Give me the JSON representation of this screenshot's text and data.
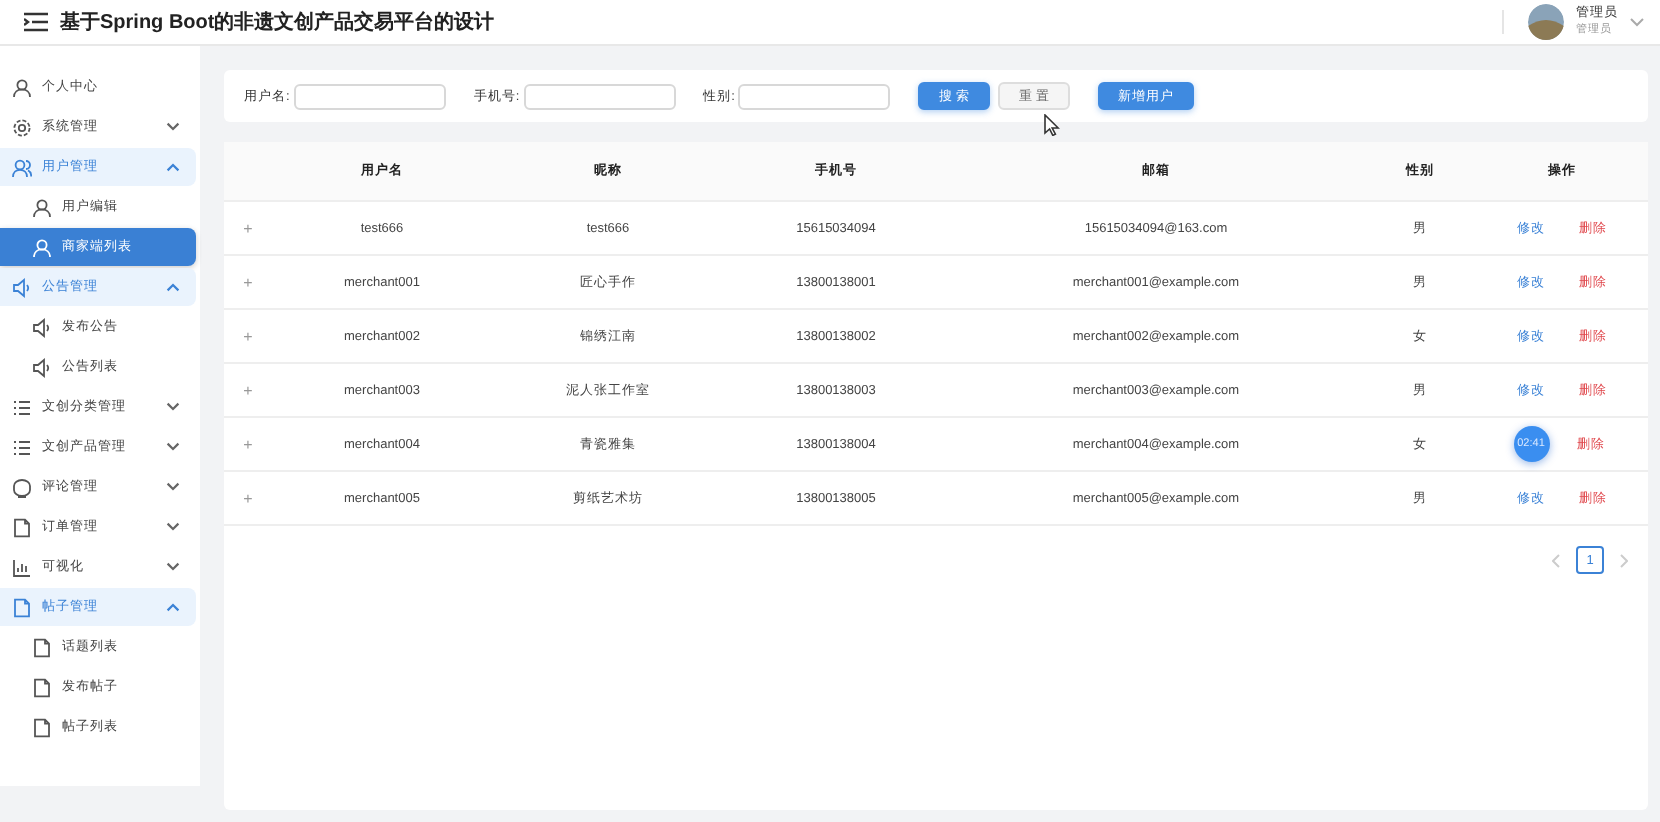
{
  "header": {
    "title": "基于Spring Boot的非遗文创产品交易平台的设计",
    "user_name": "管理员",
    "user_role": "管理员"
  },
  "sidebar": {
    "items": [
      {
        "label": "个人中心",
        "kind": "user",
        "selected": false
      },
      {
        "label": "系统管理",
        "kind": "gear",
        "expanded": false,
        "selected": false
      },
      {
        "label": "用户管理",
        "kind": "users",
        "expanded": true,
        "selected": false,
        "children": [
          {
            "label": "用户编辑",
            "kind": "user",
            "selected": false
          },
          {
            "label": "商家端列表",
            "kind": "user",
            "selected": true
          }
        ]
      },
      {
        "label": "公告管理",
        "kind": "speaker",
        "expanded": true,
        "selected": false,
        "children": [
          {
            "label": "发布公告",
            "kind": "speaker",
            "selected": false
          },
          {
            "label": "公告列表",
            "kind": "speaker",
            "selected": false
          }
        ]
      },
      {
        "label": "文创分类管理",
        "kind": "list",
        "expanded": false,
        "selected": false
      },
      {
        "label": "文创产品管理",
        "kind": "list",
        "expanded": false,
        "selected": false
      },
      {
        "label": "评论管理",
        "kind": "chat",
        "expanded": false,
        "selected": false
      },
      {
        "label": "订单管理",
        "kind": "doc",
        "expanded": false,
        "selected": false
      },
      {
        "label": "可视化",
        "kind": "chart",
        "expanded": false,
        "selected": false
      },
      {
        "label": "帖子管理",
        "kind": "doc",
        "expanded": true,
        "selected": false,
        "children": [
          {
            "label": "话题列表",
            "kind": "doc",
            "selected": false
          },
          {
            "label": "发布帖子",
            "kind": "doc",
            "selected": false
          },
          {
            "label": "帖子列表",
            "kind": "doc",
            "selected": false
          }
        ]
      }
    ]
  },
  "search": {
    "fields": [
      {
        "label": "用户名:"
      },
      {
        "label": "手机号:"
      },
      {
        "label": "性别:"
      }
    ],
    "buttons": [
      {
        "label": "搜 索",
        "kind": "primary"
      },
      {
        "label": "重 置",
        "kind": "plain"
      },
      {
        "label": "新增用户",
        "kind": "primary"
      }
    ]
  },
  "table": {
    "columns": [
      "用户名",
      "昵称",
      "手机号",
      "邮箱",
      "性别",
      "操作"
    ],
    "rows": [
      {
        "expand": "+",
        "cells": [
          "test666",
          "test666",
          "15615034094",
          "15615034094@163.com",
          "男"
        ],
        "actions": [
          {
            "kind": "edit",
            "label": "修改"
          },
          {
            "kind": "delete",
            "label": "删除"
          }
        ]
      },
      {
        "expand": "+",
        "cells": [
          "merchant001",
          "匠心手作",
          "13800138001",
          "merchant001@example.com",
          "男"
        ],
        "actions": [
          {
            "kind": "edit",
            "label": "修改"
          },
          {
            "kind": "delete",
            "label": "删除"
          }
        ]
      },
      {
        "expand": "+",
        "cells": [
          "merchant002",
          "锦绣江南",
          "13800138002",
          "merchant002@example.com",
          "女"
        ],
        "actions": [
          {
            "kind": "edit",
            "label": "修改"
          },
          {
            "kind": "delete",
            "label": "删除"
          }
        ]
      },
      {
        "expand": "+",
        "cells": [
          "merchant003",
          "泥人张工作室",
          "13800138003",
          "merchant003@example.com",
          "男"
        ],
        "actions": [
          {
            "kind": "edit",
            "label": "修改"
          },
          {
            "kind": "delete",
            "label": "删除"
          }
        ]
      },
      {
        "expand": "+",
        "cells": [
          "merchant004",
          "青瓷雅集",
          "13800138004",
          "merchant004@example.com",
          "女"
        ],
        "actions": [
          {
            "kind": "timer",
            "label": "02:41"
          },
          {
            "kind": "delete",
            "label": "删除"
          }
        ]
      },
      {
        "expand": "+",
        "cells": [
          "merchant005",
          "剪纸艺术坊",
          "13800138005",
          "merchant005@example.com",
          "男"
        ],
        "actions": [
          {
            "kind": "edit",
            "label": "修改"
          },
          {
            "kind": "delete",
            "label": "删除"
          }
        ]
      }
    ]
  },
  "pagination": {
    "pages": [
      {
        "label": "1",
        "selected": true
      }
    ]
  }
}
